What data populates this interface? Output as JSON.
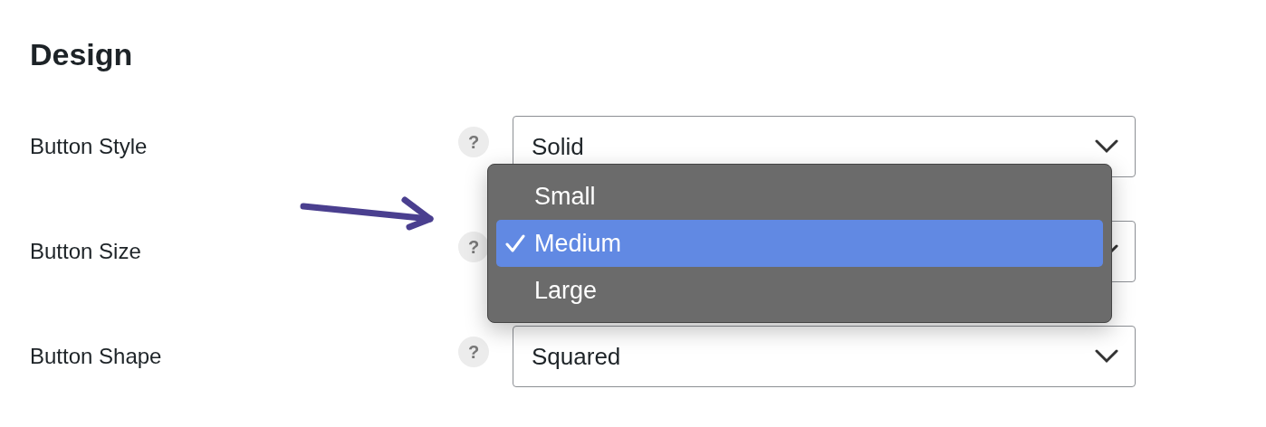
{
  "heading": "Design",
  "fields": [
    {
      "label": "Button Style",
      "help": "?",
      "value": "Solid",
      "open": false
    },
    {
      "label": "Button Size",
      "help": "?",
      "open": true,
      "options": [
        {
          "label": "Small",
          "selected": false
        },
        {
          "label": "Medium",
          "selected": true
        },
        {
          "label": "Large",
          "selected": false
        }
      ]
    },
    {
      "label": "Button Shape",
      "help": "?",
      "value": "Squared",
      "open": false
    }
  ]
}
